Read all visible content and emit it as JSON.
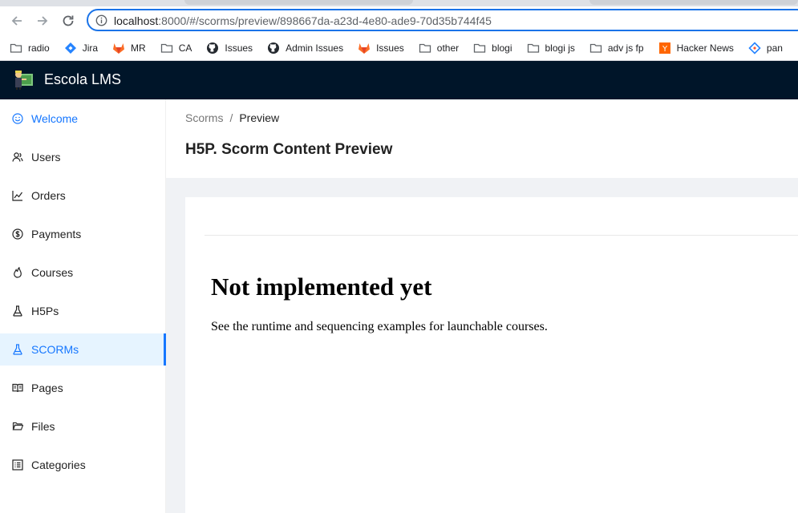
{
  "browser": {
    "url_host": "localhost",
    "url_rest": ":8000/#/scorms/preview/898667da-a23d-4e80-ade9-70d35b744f45",
    "accent": "#1a73e8",
    "bookmarks": [
      {
        "label": "radio",
        "icon": "folder-icon"
      },
      {
        "label": "Jira",
        "icon": "jira-icon"
      },
      {
        "label": "MR",
        "icon": "gitlab-icon"
      },
      {
        "label": "CA",
        "icon": "folder-icon"
      },
      {
        "label": "Issues",
        "icon": "github-icon"
      },
      {
        "label": "Admin Issues",
        "icon": "github-icon"
      },
      {
        "label": "Issues",
        "icon": "gitlab-icon"
      },
      {
        "label": "other",
        "icon": "folder-icon"
      },
      {
        "label": "blogi",
        "icon": "folder-icon"
      },
      {
        "label": "blogi js",
        "icon": "folder-icon"
      },
      {
        "label": "adv js fp",
        "icon": "folder-icon"
      },
      {
        "label": "Hacker News",
        "icon": "hacker-news-icon"
      },
      {
        "label": "pan",
        "icon": "diamond-icon"
      }
    ]
  },
  "app": {
    "title": "Escola LMS",
    "header_bg": "#001529",
    "accent": "#1677ff"
  },
  "sidebar": {
    "items": [
      {
        "label": "Welcome",
        "icon": "smile-icon"
      },
      {
        "label": "Users",
        "icon": "users-icon"
      },
      {
        "label": "Orders",
        "icon": "chart-icon"
      },
      {
        "label": "Payments",
        "icon": "dollar-icon"
      },
      {
        "label": "Courses",
        "icon": "fire-icon"
      },
      {
        "label": "H5Ps",
        "icon": "flask-icon"
      },
      {
        "label": "SCORMs",
        "icon": "flask-icon",
        "active": true
      },
      {
        "label": "Pages",
        "icon": "book-icon"
      },
      {
        "label": "Files",
        "icon": "folder-open-icon"
      },
      {
        "label": "Categories",
        "icon": "list-icon"
      }
    ]
  },
  "breadcrumb": {
    "parent": "Scorms",
    "separator": "/",
    "current": "Preview"
  },
  "page": {
    "title": "H5P. Scorm Content Preview"
  },
  "content": {
    "heading": "Not implemented yet",
    "text": "See the runtime and sequencing examples for launchable courses."
  }
}
